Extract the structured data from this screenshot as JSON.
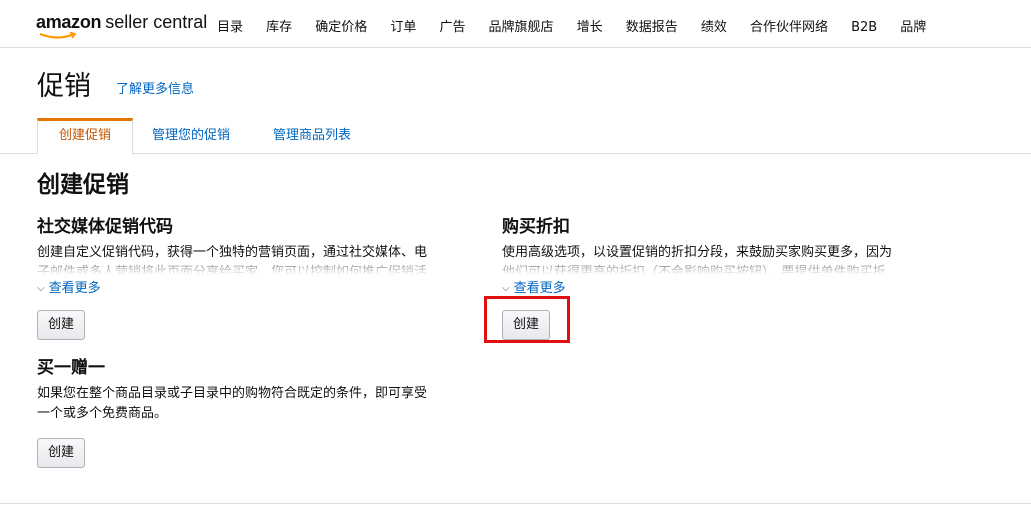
{
  "brand": {
    "logo_main": "amazon",
    "logo_sub": "seller central"
  },
  "nav": {
    "items": [
      "目录",
      "库存",
      "确定价格",
      "订单",
      "广告",
      "品牌旗舰店",
      "增长",
      "数据报告",
      "绩效",
      "合作伙伴网络",
      "B2B",
      "品牌"
    ]
  },
  "page": {
    "title": "促销",
    "learn_more": "了解更多信息"
  },
  "tabs": [
    "创建促销",
    "管理您的促销",
    "管理商品列表"
  ],
  "active_tab": "创建促销",
  "section": {
    "title": "创建促销"
  },
  "cards": {
    "social": {
      "title": "社交媒体促销代码",
      "line1": "创建自定义促销代码，获得一个独特的营销页面，通过社交媒体、电",
      "line2": "子邮件或多人营销将此页面分享给买家。您可以控制如何推广促销活",
      "see_more": "查看更多",
      "button": "创建"
    },
    "purchase_discount": {
      "title": "购买折扣",
      "line1": "使用高级选项，以设置促销的折扣分段，来鼓励买家购买更多，因为",
      "line2": "他们可以获得更高的折扣（不会影响购买按钮）。要提供单件购买折",
      "see_more": "查看更多",
      "button": "创建"
    },
    "bogo": {
      "title": "买一赠一",
      "line1": "如果您在整个商品目录或子目录中的购物符合既定的条件，即可享受",
      "line2": "一个或多个免费商品。",
      "button": "创建"
    }
  },
  "colors": {
    "link": "#0066c0",
    "active_tab": "#c45500",
    "tab_accent": "#e77600",
    "highlight": "#e01010"
  },
  "icons": {
    "see_more": "chevron-down-icon"
  }
}
